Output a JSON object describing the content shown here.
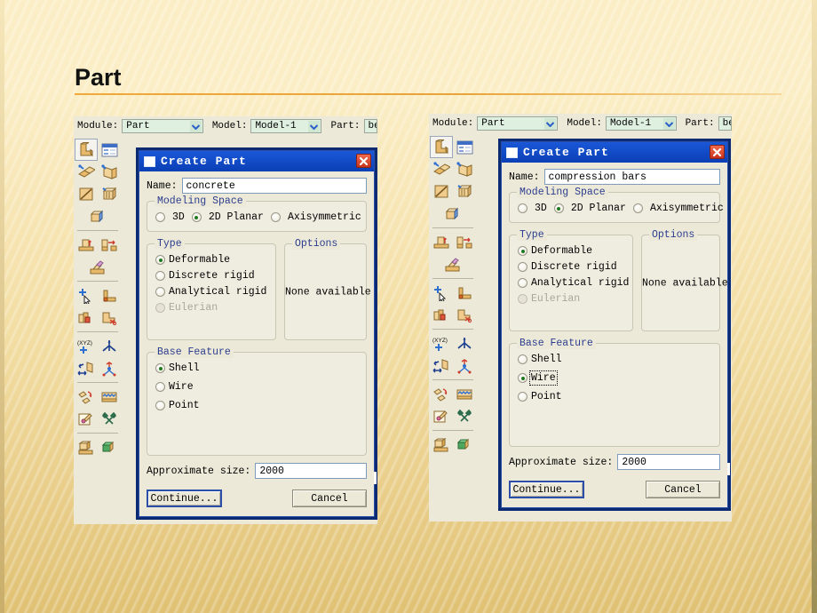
{
  "slide": {
    "title": "Part",
    "accent_color": "#f0a93a",
    "background_color": "#f2dda2"
  },
  "windows": [
    {
      "id": "left",
      "menubar": {
        "module_label": "Module:",
        "module_value": "Part",
        "model_label": "Model:",
        "model_value": "Model-1",
        "part_label": "Part:",
        "part_value": "be"
      },
      "dialog": {
        "title": "Create Part",
        "close_icon": "close-x-icon",
        "system_icon": "window-system-icon",
        "name_label": "Name:",
        "name_value": "concrete",
        "modeling_space": {
          "title": "Modeling Space",
          "options": [
            "3D",
            "2D Planar",
            "Axisymmetric"
          ],
          "selected": "2D Planar"
        },
        "type": {
          "title": "Type",
          "options": [
            "Deformable",
            "Discrete rigid",
            "Analytical rigid",
            "Eulerian"
          ],
          "disabled": [
            "Eulerian"
          ],
          "selected": "Deformable"
        },
        "options_group": {
          "title": "Options",
          "text": "None available"
        },
        "base_feature": {
          "title": "Base Feature",
          "options": [
            "Shell",
            "Wire",
            "Point"
          ],
          "selected": "Shell",
          "focused": null
        },
        "approx_size_label": "Approximate size:",
        "approx_size_value": "2000",
        "continue_label": "Continue...",
        "cancel_label": "Cancel"
      }
    },
    {
      "id": "right",
      "menubar": {
        "module_label": "Module:",
        "module_value": "Part",
        "model_label": "Model:",
        "model_value": "Model-1",
        "part_label": "Part:",
        "part_value": "be"
      },
      "dialog": {
        "title": "Create Part",
        "close_icon": "close-x-icon",
        "system_icon": "window-system-icon",
        "name_label": "Name:",
        "name_value": "compression bars",
        "modeling_space": {
          "title": "Modeling Space",
          "options": [
            "3D",
            "2D Planar",
            "Axisymmetric"
          ],
          "selected": "2D Planar"
        },
        "type": {
          "title": "Type",
          "options": [
            "Deformable",
            "Discrete rigid",
            "Analytical rigid",
            "Eulerian"
          ],
          "disabled": [
            "Eulerian"
          ],
          "selected": "Deformable"
        },
        "options_group": {
          "title": "Options",
          "text": "None available"
        },
        "base_feature": {
          "title": "Base Feature",
          "options": [
            "Shell",
            "Wire",
            "Point"
          ],
          "selected": "Wire",
          "focused": "Wire"
        },
        "approx_size_label": "Approximate size:",
        "approx_size_value": "2000",
        "continue_label": "Continue...",
        "cancel_label": "Cancel"
      }
    }
  ],
  "toolbox": {
    "groups": [
      {
        "rows": [
          [
            "create-part-icon",
            "part-manager-icon"
          ],
          [
            "create-shell-extrude-icon",
            "create-shell-revolve-icon"
          ],
          [
            "create-wire-icon",
            "create-solid-sweep-icon"
          ],
          [
            "create-solid-icon"
          ]
        ]
      },
      {
        "rows": [
          [
            "create-cut-extrude-icon",
            "create-cut-revolve-icon"
          ],
          [
            "create-blend-icon"
          ]
        ]
      },
      {
        "rows": [
          [
            "create-point-icon",
            "create-edge-icon"
          ],
          [
            "create-round-icon",
            "partition-cell-icon"
          ]
        ]
      },
      {
        "rows": [
          [
            "create-datum-csys-icon",
            "create-datum-axis-icon"
          ],
          [
            "create-datum-plane-icon",
            "create-datum-point-icon"
          ]
        ]
      },
      {
        "rows": [
          [
            "mirror-pattern-icon",
            "linear-pattern-icon"
          ],
          [
            "edit-feature-icon",
            "tools-icon"
          ]
        ]
      },
      {
        "rows": [
          [
            "assign-section-icon",
            "merge-cut-icon"
          ]
        ]
      }
    ]
  }
}
